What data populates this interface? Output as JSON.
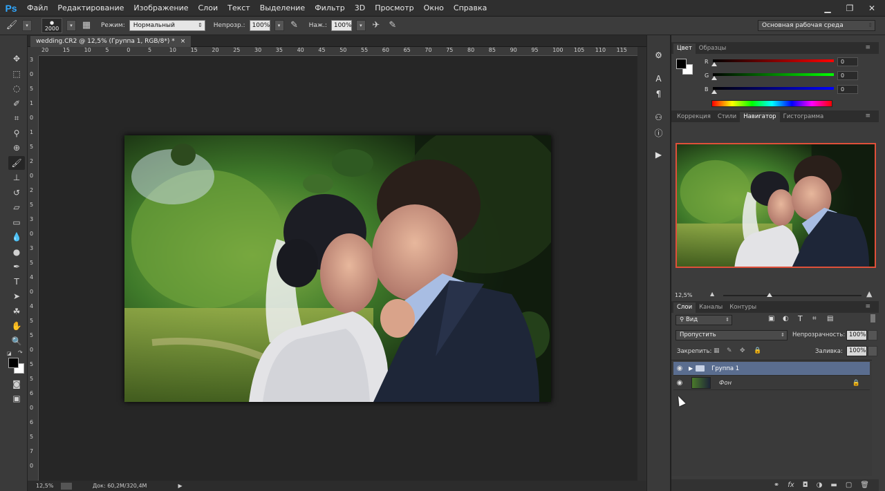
{
  "app": {
    "logo": "Ps"
  },
  "menu": [
    "Файл",
    "Редактирование",
    "Изображение",
    "Слои",
    "Текст",
    "Выделение",
    "Фильтр",
    "3D",
    "Просмотр",
    "Окно",
    "Справка"
  ],
  "window_controls": {
    "minimize": "▁",
    "restore": "❐",
    "close": "✕"
  },
  "options_bar": {
    "brush_size": "2000",
    "mode_label": "Режим:",
    "mode_value": "Нормальный",
    "opacity_label": "Непрозр.:",
    "opacity_value": "100%",
    "flow_label": "Наж.:",
    "flow_value": "100%",
    "workspace": "Основная рабочая среда"
  },
  "document": {
    "tab_title": "wedding.CR2 @ 12,5% (Группа 1, RGB/8*) *",
    "tab_close": "×",
    "ruler_top": [
      "20",
      "15",
      "10",
      "5",
      "0",
      "5",
      "10",
      "15",
      "20",
      "25",
      "30",
      "35",
      "40",
      "45",
      "50",
      "55",
      "60",
      "65",
      "70",
      "75",
      "80",
      "85",
      "90",
      "95",
      "100",
      "105",
      "110",
      "115"
    ],
    "ruler_left": [
      "3",
      "0",
      "5",
      "1",
      "0",
      "1",
      "5",
      "2",
      "0",
      "2",
      "5",
      "3",
      "0",
      "3",
      "5",
      "4",
      "0",
      "4",
      "5",
      "5",
      "0",
      "5",
      "5",
      "6",
      "0",
      "6",
      "5",
      "7",
      "0"
    ]
  },
  "status_bar": {
    "zoom": "12,5%",
    "doc_info": "Док: 60,2M/320,4M"
  },
  "color_panel": {
    "tabs": [
      "Цвет",
      "Образцы"
    ],
    "active_tab": "Цвет",
    "r_label": "R",
    "r_value": "0",
    "g_label": "G",
    "g_value": "0",
    "b_label": "B",
    "b_value": "0"
  },
  "navigator_panel": {
    "tabs": [
      "Коррекция",
      "Стили",
      "Навигатор",
      "Гистограмма"
    ],
    "active_tab": "Навигатор",
    "zoom": "12,5%"
  },
  "layers_panel": {
    "tabs": [
      "Слои",
      "Каналы",
      "Контуры"
    ],
    "active_tab": "Слои",
    "filter_kind": "Вид",
    "blend_mode": "Пропустить",
    "opacity_label": "Непрозрачность:",
    "opacity_value": "100%",
    "lock_label": "Закрепить:",
    "fill_label": "Заливка:",
    "fill_value": "100%",
    "layers": [
      {
        "name": "Группа 1",
        "type": "group",
        "selected": true
      },
      {
        "name": "Фон",
        "type": "background",
        "selected": false
      }
    ]
  },
  "colors": {
    "accent_nav_border": "#e0503a",
    "layer_selected": "#5a6d8f"
  }
}
